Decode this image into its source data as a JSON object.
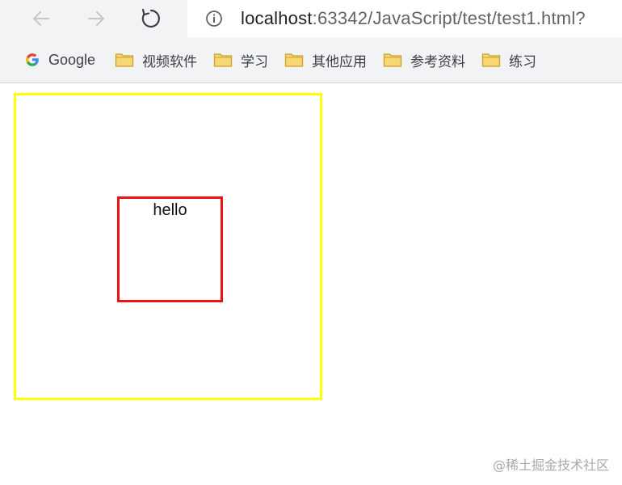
{
  "browser": {
    "address_bar": {
      "url_host": "localhost",
      "url_path": ":63342/JavaScript/test/test1.html?"
    },
    "nav_icons": {
      "back": "arrow-left-icon",
      "forward": "arrow-right-icon",
      "reload": "reload-icon",
      "info": "info-icon"
    },
    "bookmarks": [
      {
        "label": "Google",
        "icon": "google-logo-icon"
      },
      {
        "label": "视频软件",
        "icon": "folder-icon"
      },
      {
        "label": "学习",
        "icon": "folder-icon"
      },
      {
        "label": "其他应用",
        "icon": "folder-icon"
      },
      {
        "label": "参考资料",
        "icon": "folder-icon"
      },
      {
        "label": "练习",
        "icon": "folder-icon"
      }
    ]
  },
  "page": {
    "inner_box_text": "hello",
    "watermark": "@稀土掘金技术社区"
  },
  "colors": {
    "outer_box_border": "#ffff00",
    "inner_box_border": "#ee1111",
    "folder_fill": "#f8d775",
    "folder_stroke": "#c9a227"
  }
}
